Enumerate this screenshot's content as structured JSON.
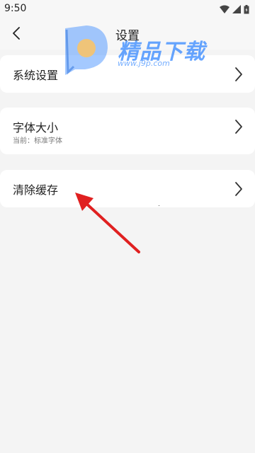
{
  "status_bar": {
    "time": "9:50",
    "icons": [
      "wifi-icon",
      "signal-icon",
      "battery-icon"
    ]
  },
  "header": {
    "title": "设置",
    "back_icon": "chevron-left-icon"
  },
  "watermark": {
    "brand": "精品下载",
    "url": "www.j9p.com",
    "color": "#3c8cff"
  },
  "settings": {
    "system": {
      "title": "系统设置"
    },
    "font_size": {
      "title": "字体大小",
      "subtitle": "当前：标准字体"
    },
    "clear_cache": {
      "title": "清除缓存"
    }
  },
  "annotation": {
    "arrow_color": "#e02020"
  }
}
